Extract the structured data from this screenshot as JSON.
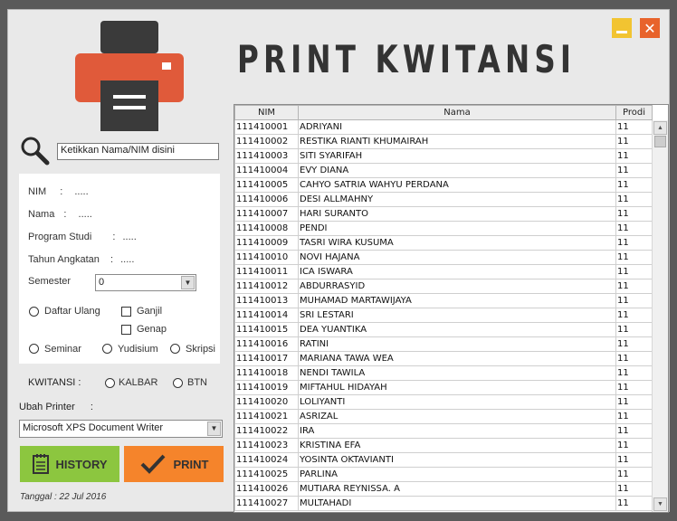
{
  "title": "PRINT KWITANSI",
  "icons": {
    "logo": "printer-icon",
    "search": "magnifier-icon",
    "history": "notepad-icon",
    "print": "checkmark-icon",
    "minimize": "minimize-icon",
    "close": "close-icon"
  },
  "colors": {
    "history_button": "#8cc63f",
    "print_button": "#f5842b",
    "minimize": "#f2c431",
    "close": "#e8632b",
    "printer_red": "#e05a3a",
    "printer_dark": "#3a3a3a"
  },
  "search": {
    "value": "Ketikkan Nama/NIM disini"
  },
  "info": {
    "nim_label": "NIM",
    "nim_value": ".....",
    "nama_label": "Nama",
    "nama_value": ".....",
    "prodi_label": "Program Studi",
    "prodi_value": ".....",
    "angkatan_label": "Tahun Angkatan",
    "angkatan_value": ".....",
    "colon": ":",
    "semester_label": "Semester",
    "semester_value": "0"
  },
  "options": {
    "daftar_ulang": "Daftar Ulang",
    "ganjil": "Ganjil",
    "genap": "Genap",
    "seminar": "Seminar",
    "yudisium": "Yudisium",
    "skripsi": "Skripsi"
  },
  "kwitansi": {
    "label": "KWITANSI :",
    "kalbar": "KALBAR",
    "btn": "BTN"
  },
  "printer": {
    "label": "Ubah Printer",
    "colon": ":",
    "value": "Microsoft XPS Document Writer"
  },
  "buttons": {
    "history": "HISTORY",
    "print": "PRINT"
  },
  "date": "Tanggal :  22 Jul 2016",
  "table": {
    "headers": [
      "NIM",
      "Nama",
      "Prodi"
    ],
    "rows": [
      [
        "111410001",
        "ADRIYANI",
        "11"
      ],
      [
        "111410002",
        "RESTIKA RIANTI KHUMAIRAH",
        "11"
      ],
      [
        "111410003",
        "SITI SYARIFAH",
        "11"
      ],
      [
        "111410004",
        "EVY DIANA",
        "11"
      ],
      [
        "111410005",
        "CAHYO SATRIA WAHYU PERDANA",
        "11"
      ],
      [
        "111410006",
        "DESI ALLMAHNY",
        "11"
      ],
      [
        "111410007",
        "HARI SURANTO",
        "11"
      ],
      [
        "111410008",
        "PENDI",
        "11"
      ],
      [
        "111410009",
        "TASRI WIRA KUSUMA",
        "11"
      ],
      [
        "111410010",
        "NOVI HAJANA",
        "11"
      ],
      [
        "111410011",
        "ICA ISWARA",
        "11"
      ],
      [
        "111410012",
        "ABDURRASYID",
        "11"
      ],
      [
        "111410013",
        "MUHAMAD MARTAWIJAYA",
        "11"
      ],
      [
        "111410014",
        "SRI LESTARI",
        "11"
      ],
      [
        "111410015",
        "DEA YUANTIKA",
        "11"
      ],
      [
        "111410016",
        "RATINI",
        "11"
      ],
      [
        "111410017",
        "MARIANA TAWA WEA",
        "11"
      ],
      [
        "111410018",
        "NENDI TAWILA",
        "11"
      ],
      [
        "111410019",
        "MIFTAHUL HIDAYAH",
        "11"
      ],
      [
        "111410020",
        "LOLIYANTI",
        "11"
      ],
      [
        "111410021",
        "ASRIZAL",
        "11"
      ],
      [
        "111410022",
        "IRA",
        "11"
      ],
      [
        "111410023",
        "KRISTINA EFA",
        "11"
      ],
      [
        "111410024",
        "YOSINTA OKTAVIANTI",
        "11"
      ],
      [
        "111410025",
        "PARLINA",
        "11"
      ],
      [
        "111410026",
        "MUTIARA REYNISSA. A",
        "11"
      ],
      [
        "111410027",
        "MULTAHADI",
        "11"
      ]
    ]
  }
}
